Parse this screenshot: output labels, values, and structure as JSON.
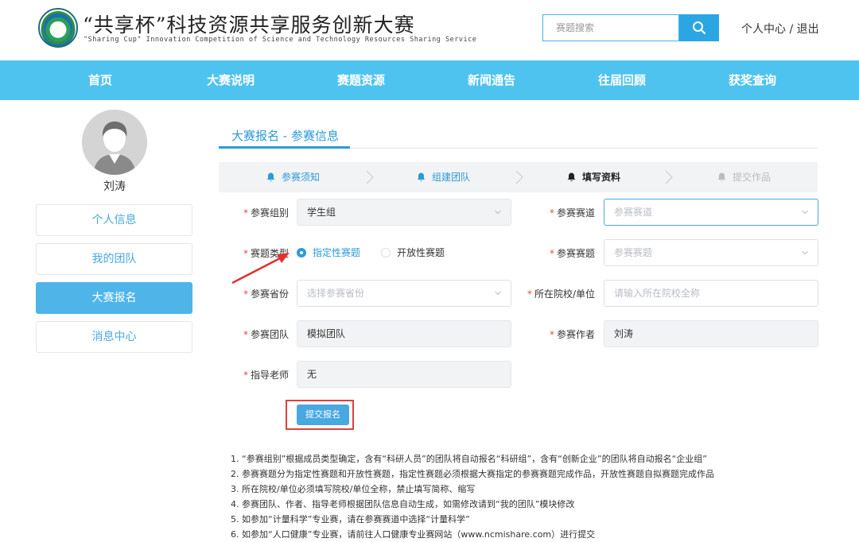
{
  "header": {
    "title_cn": "“共享杯”科技资源共享服务创新大赛",
    "title_en": "\"Sharing Cup\"  Innovation Competition of Science and Technology Resources Sharing Service",
    "search_placeholder": "赛题搜索",
    "user_center": "个人中心",
    "separator": "/",
    "logout": "退出"
  },
  "nav": {
    "items": [
      "首页",
      "大赛说明",
      "赛题资源",
      "新闻通告",
      "往届回顾",
      "获奖查询"
    ]
  },
  "sidebar": {
    "username": "刘涛",
    "items": [
      {
        "label": "个人信息"
      },
      {
        "label": "我的团队"
      },
      {
        "label": "大赛报名"
      },
      {
        "label": "消息中心"
      }
    ]
  },
  "main": {
    "title": "大赛报名 - 参赛信息",
    "steps": [
      "参赛须知",
      "组建团队",
      "填写资料",
      "提交作品"
    ],
    "form": {
      "group_label": "参赛组别",
      "group_value": "学生组",
      "track_label": "参赛赛道",
      "track_placeholder": "参赛赛道",
      "type_label": "赛题类型",
      "type_options": [
        "指定性赛题",
        "开放性赛题"
      ],
      "topic_label": "参赛赛题",
      "topic_placeholder": "参赛赛题",
      "province_label": "参赛省份",
      "province_placeholder": "选择参赛省份",
      "school_label": "所在院校/单位",
      "school_placeholder": "请输入所在院校全称",
      "team_label": "参赛团队",
      "team_value": "模拟团队",
      "author_label": "参赛作者",
      "author_value": "刘涛",
      "teacher_label": "指导老师",
      "teacher_value": "无",
      "submit_label": "提交报名"
    },
    "notes": [
      "1. “参赛组别”根据成员类型确定，含有“科研人员”的团队将自动报名“科研组”，含有“创新企业”的团队将自动报名“企业组”",
      "2. 参赛赛题分为指定性赛题和开放性赛题，指定性赛题必须根据大赛指定的参赛赛题完成作品，开放性赛题自拟赛题完成作品",
      "3. 所在院校/单位必须填写院校/单位全称，禁止填写简称、缩写",
      "4. 参赛团队、作者、指导老师根据团队信息自动生成，如需修改请到“我的团队”模块修改",
      "5. 如参加“计量科学”专业赛，请在参赛赛道中选择“计量科学”",
      "6. 如参加“人口健康”专业赛，请前往人口健康专业赛网站（www.ncmishare.com）进行提交"
    ]
  },
  "colors": {
    "nav_bg": "#4fc3ef",
    "accent": "#2c9ad8",
    "sidebar_active": "#4fb5e9",
    "required": "#e24b4b",
    "highlight": "#e04040"
  }
}
